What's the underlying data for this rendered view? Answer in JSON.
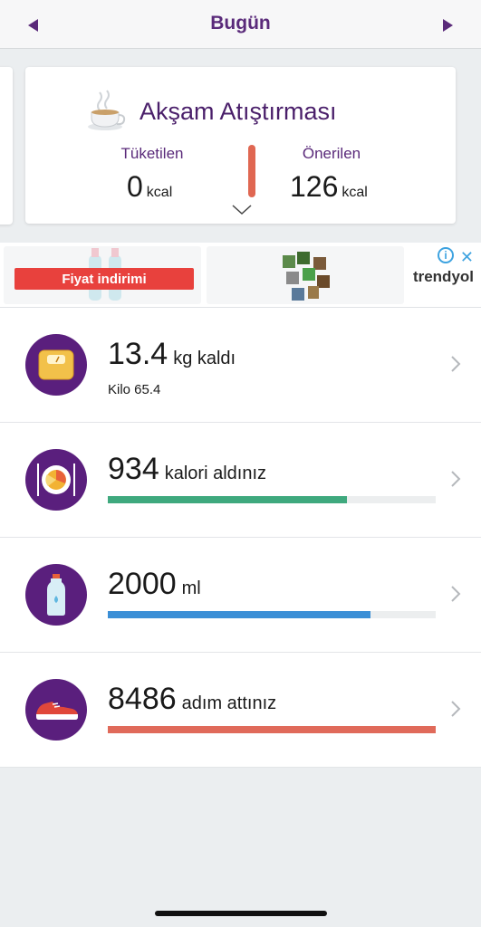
{
  "header": {
    "title": "Bugün",
    "prev_icon": "triangle-left-icon",
    "next_icon": "triangle-right-icon",
    "accent": "#5a2a7a"
  },
  "meal_card": {
    "title": "Akşam Atıştırması",
    "icon": "teacup-icon",
    "consumed_label": "Tüketilen",
    "consumed_value": "0",
    "consumed_unit": "kcal",
    "recommended_label": "Önerilen",
    "recommended_value": "126",
    "recommended_unit": "kcal",
    "bar_color": "#e06752"
  },
  "ad": {
    "badge": "Fiyat indirimi",
    "brand": "trendyol",
    "info_icon": "info-icon",
    "close_icon": "close-icon"
  },
  "stats": [
    {
      "icon": "scale-icon",
      "value": "13.4",
      "unit": "kg kaldı",
      "sub": "Kilo 65.4"
    },
    {
      "icon": "plate-icon",
      "value": "934",
      "unit": "kalori aldınız",
      "progress": 0.73,
      "color": "#3fa97e"
    },
    {
      "icon": "water-bottle-icon",
      "value": "2000",
      "unit": "ml",
      "progress": 0.8,
      "color": "#3b8fd6"
    },
    {
      "icon": "sneaker-icon",
      "value": "8486",
      "unit": "adım attınız",
      "progress": 1.0,
      "color": "#e06a5a"
    }
  ]
}
